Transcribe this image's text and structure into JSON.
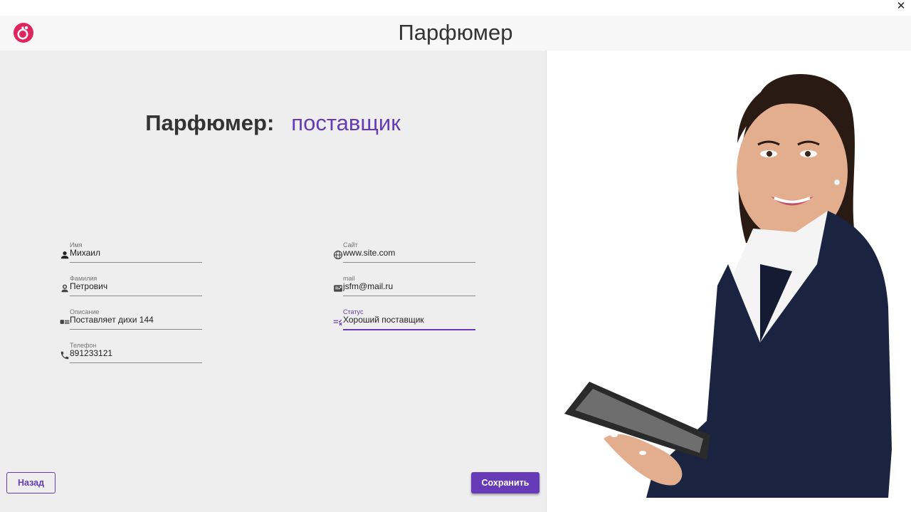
{
  "window": {
    "close_glyph": "✕"
  },
  "header": {
    "title": "Парфюмер",
    "logo_icon": "perfume-logo-icon",
    "logo_color": "#e0245e"
  },
  "heading": {
    "label": "Парфюмер:",
    "value": "поставщик"
  },
  "fields": {
    "name": {
      "label": "Имя",
      "value": "Михаил",
      "icon": "person-icon"
    },
    "surname": {
      "label": "Фамилия",
      "value": "Петрович",
      "icon": "person-outline-icon"
    },
    "description": {
      "label": "Описание",
      "value": "Поставляет дихи 144",
      "icon": "description-card-icon"
    },
    "phone": {
      "label": "Телефон",
      "value": "891233121",
      "icon": "phone-icon"
    },
    "site": {
      "label": "Сайт",
      "value": "www.site.com",
      "icon": "globe-icon"
    },
    "mail": {
      "label": "mail",
      "value": "jsfm@mail.ru",
      "icon": "email-icon"
    },
    "status": {
      "label": "Статус",
      "value": "Хороший поставщик",
      "icon": "status-list-icon",
      "focused": true
    }
  },
  "buttons": {
    "back": "Назад",
    "save": "Сохранить"
  },
  "colors": {
    "accent": "#673ab7",
    "panel_bg": "#eeeeee",
    "header_bg": "#f7f7f7"
  }
}
